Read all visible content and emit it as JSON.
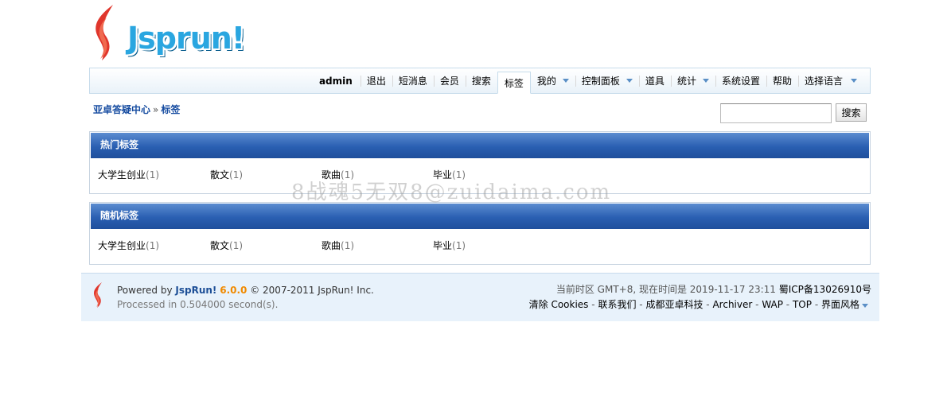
{
  "logo": {
    "text": "Jsprun!"
  },
  "nav": {
    "user": "admin",
    "items": [
      {
        "label": "退出",
        "dropdown": false
      },
      {
        "label": "短消息",
        "dropdown": false
      },
      {
        "label": "会员",
        "dropdown": false
      },
      {
        "label": "搜索",
        "dropdown": false
      },
      {
        "label": "标签",
        "dropdown": false,
        "active": true
      },
      {
        "label": "我的",
        "dropdown": true
      },
      {
        "label": "控制面板",
        "dropdown": true
      },
      {
        "label": "道具",
        "dropdown": false
      },
      {
        "label": "统计",
        "dropdown": true
      },
      {
        "label": "系统设置",
        "dropdown": false
      },
      {
        "label": "帮助",
        "dropdown": false
      },
      {
        "label": "选择语言",
        "dropdown": true
      }
    ]
  },
  "breadcrumb": {
    "home": "亚卓答疑中心",
    "separator": "»",
    "current": "标签"
  },
  "search": {
    "value": "",
    "button_label": "搜索"
  },
  "hot_tags": {
    "title": "热门标签",
    "tags": [
      {
        "name": "大学生创业",
        "count": "(1)"
      },
      {
        "name": "散文",
        "count": "(1)"
      },
      {
        "name": "歌曲",
        "count": "(1)"
      },
      {
        "name": "毕业",
        "count": "(1)"
      }
    ]
  },
  "random_tags": {
    "title": "随机标签",
    "tags": [
      {
        "name": "大学生创业",
        "count": "(1)"
      },
      {
        "name": "散文",
        "count": "(1)"
      },
      {
        "name": "歌曲",
        "count": "(1)"
      },
      {
        "name": "毕业",
        "count": "(1)"
      }
    ]
  },
  "watermark": "8战魂5无双8@zuidaima.com",
  "footer": {
    "powered_prefix": "Powered by",
    "brand": "JspRun!",
    "version": "6.0.0",
    "copyright": "© 2007-2011 JspRun! Inc.",
    "processed": "Processed in 0.504000 second(s).",
    "timezone": "当前时区 GMT+8, 现在时间是 2019-11-17 23:11",
    "icp": "蜀ICP备13026910号",
    "links": [
      "清除 Cookies",
      "联系我们",
      "成都亚卓科技",
      "Archiver",
      "WAP",
      "TOP",
      "界面风格"
    ],
    "link_separator": "-"
  },
  "colors": {
    "brand_blue": "#2aa6e0",
    "nav_border": "#c7dceb",
    "box_header": "#2a5fb2",
    "breadcrumb": "#154ba0",
    "footer_bg": "#e8f2fb",
    "version_orange": "#f08a00"
  }
}
